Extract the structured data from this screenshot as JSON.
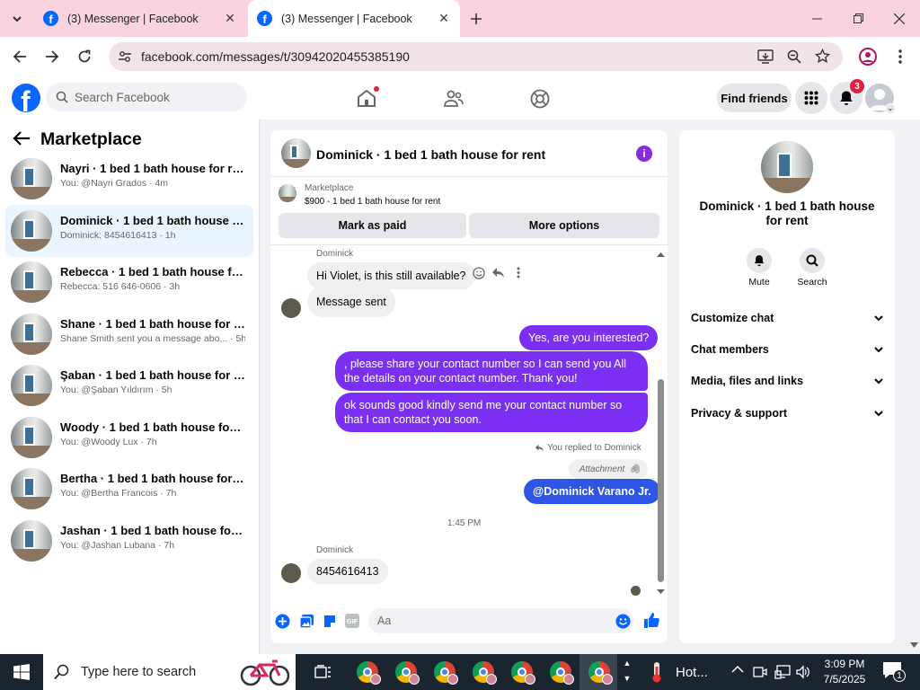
{
  "browser": {
    "tabs": [
      {
        "title": "(3) Messenger | Facebook",
        "active": false
      },
      {
        "title": "(3) Messenger | Facebook",
        "active": true
      }
    ],
    "url": "facebook.com/messages/t/30942020455385190"
  },
  "fb_header": {
    "search_placeholder": "Search Facebook",
    "find_friends": "Find friends",
    "notif_count": "3"
  },
  "sidebar": {
    "title": "Marketplace",
    "conversations": [
      {
        "name": "Nayri · 1 bed 1 bath house for rent",
        "sub": "You: @Nayri Grados · 4m"
      },
      {
        "name": "Dominick · 1 bed 1 bath house for rent",
        "sub": "Dominick: 8454616413 · 1h"
      },
      {
        "name": "Rebecca · 1 bed 1 bath house for rent",
        "sub": "Rebecca: 516 646-0606 · 3h"
      },
      {
        "name": "Shane · 1 bed 1 bath house for rent",
        "sub": "Shane Smith sent you a message abo... · 5h"
      },
      {
        "name": "Şaban · 1 bed 1 bath house for rent",
        "sub": "You: @Şaban Yıldırım · 5h"
      },
      {
        "name": "Woody · 1 bed 1 bath house for rent",
        "sub": "You: @Woody Lux · 7h"
      },
      {
        "name": "Bertha · 1 bed 1 bath house for rent",
        "sub": "You: @Bertha Francois · 7h"
      },
      {
        "name": "Jashan · 1 bed 1 bath house for rent",
        "sub": "You: @Jashan Lubana · 7h"
      }
    ]
  },
  "chat": {
    "title": "Dominick · 1 bed 1 bath house for rent",
    "listing_label": "Marketplace",
    "listing_detail": "$900 - 1 bed 1 bath house for rent",
    "mark_paid": "Mark as paid",
    "more_options": "More options",
    "sender1": "Dominick",
    "msg1": "Hi Violet, is this still available?",
    "msg2": "Message sent",
    "out1": "Yes, are you interested?",
    "out2": ", please share your contact number so I can send you All the details on your contact number. Thank you!",
    "out3": "ok sounds good kindly send me your contact number so that I can contact you soon.",
    "replied": "You replied to Dominick",
    "attachment": "Attachment",
    "out4": "@Dominick Varano Jr.",
    "time": "1:45 PM",
    "sender2": "Dominick",
    "msg3": "8454616413",
    "composer_placeholder": "Aa",
    "gif": "GIF"
  },
  "right_panel": {
    "title": "Dominick · 1 bed 1 bath house for rent",
    "mute": "Mute",
    "search": "Search",
    "sections": [
      "Customize chat",
      "Chat members",
      "Media, files and links",
      "Privacy & support"
    ]
  },
  "taskbar": {
    "search_placeholder": "Type here to search",
    "weather": "Hot...",
    "time": "3:09 PM",
    "date": "7/5/2025",
    "notif": "1"
  },
  "colors": {
    "accent": "#7b2ff2",
    "mention": "#2e56e6",
    "fb_blue": "#0866ff",
    "tab_strip": "#f9d3df"
  }
}
